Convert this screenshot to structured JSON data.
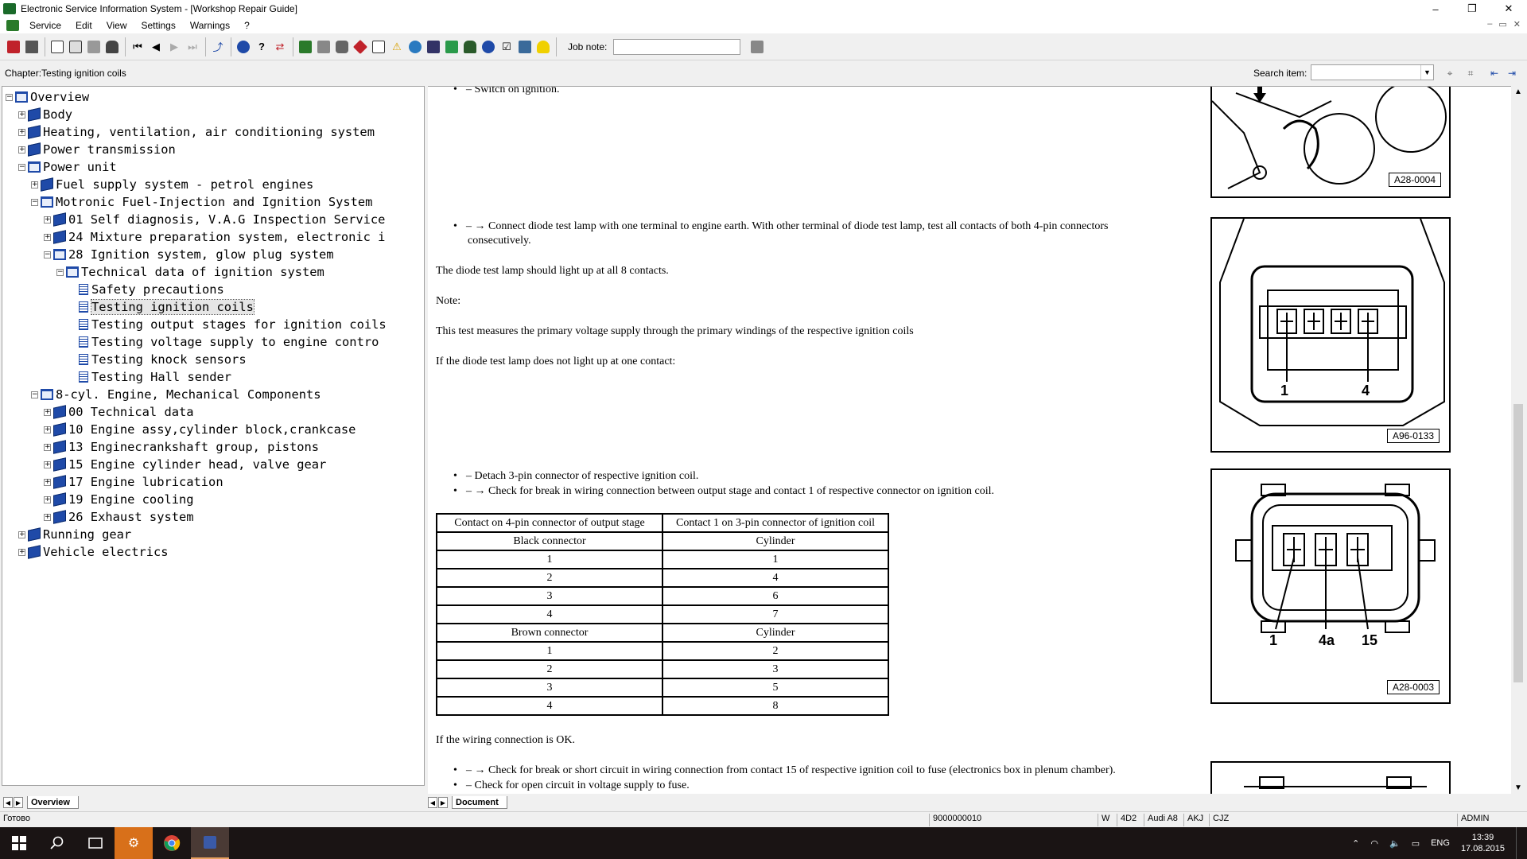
{
  "window": {
    "title": "Electronic Service Information System - [Workshop Repair Guide]",
    "controls": [
      "–",
      "❐",
      "✕"
    ]
  },
  "menu": {
    "items": [
      "Service",
      "Edit",
      "View",
      "Settings",
      "Warnings",
      "?"
    ],
    "mdi_controls": [
      "–",
      "▭",
      "✕"
    ]
  },
  "toolbar": {
    "job_note_label": "Job note:",
    "job_note_value": ""
  },
  "chapter": {
    "text": "Chapter:Testing ignition coils",
    "search_label": "Search item:",
    "search_value": ""
  },
  "tree": [
    {
      "label": "Overview",
      "expander": "−",
      "icon": "book-open",
      "level": 0
    },
    {
      "label": "Body",
      "expander": "+",
      "icon": "book-closed",
      "level": 1
    },
    {
      "label": "Heating, ventilation, air conditioning system",
      "expander": "+",
      "icon": "book-closed",
      "level": 1
    },
    {
      "label": "Power transmission",
      "expander": "+",
      "icon": "book-closed",
      "level": 1
    },
    {
      "label": "Power unit",
      "expander": "−",
      "icon": "book-open",
      "level": 1
    },
    {
      "label": "Fuel supply system - petrol engines",
      "expander": "+",
      "icon": "book-closed",
      "level": 2
    },
    {
      "label": "Motronic Fuel-Injection and Ignition System",
      "expander": "−",
      "icon": "book-open",
      "level": 2
    },
    {
      "label": "01 Self diagnosis, V.A.G Inspection Service",
      "expander": "+",
      "icon": "book-closed",
      "level": 3
    },
    {
      "label": "24 Mixture preparation system, electronic i",
      "expander": "+",
      "icon": "book-closed",
      "level": 3
    },
    {
      "label": "28 Ignition system, glow plug system",
      "expander": "−",
      "icon": "book-open",
      "level": 3
    },
    {
      "label": "Technical data of ignition system",
      "expander": "−",
      "icon": "book-open",
      "level": 4
    },
    {
      "label": "Safety precautions",
      "expander": "",
      "icon": "page",
      "level": 5
    },
    {
      "label": "Testing ignition coils",
      "expander": "",
      "icon": "page",
      "level": 5,
      "selected": true
    },
    {
      "label": "Testing output stages for ignition coils",
      "expander": "",
      "icon": "page",
      "level": 5
    },
    {
      "label": "Testing voltage supply to engine contro",
      "expander": "",
      "icon": "page",
      "level": 5
    },
    {
      "label": "Testing knock sensors",
      "expander": "",
      "icon": "page",
      "level": 5
    },
    {
      "label": "Testing Hall sender",
      "expander": "",
      "icon": "page",
      "level": 5
    },
    {
      "label": "8-cyl. Engine, Mechanical Components",
      "expander": "−",
      "icon": "book-open",
      "level": 2
    },
    {
      "label": "00 Technical data",
      "expander": "+",
      "icon": "book-closed",
      "level": 3
    },
    {
      "label": "10 Engine assy,cylinder block,crankcase",
      "expander": "+",
      "icon": "book-closed",
      "level": 3
    },
    {
      "label": "13 Enginecrankshaft group, pistons",
      "expander": "+",
      "icon": "book-closed",
      "level": 3
    },
    {
      "label": "15 Engine cylinder head, valve gear",
      "expander": "+",
      "icon": "book-closed",
      "level": 3
    },
    {
      "label": "17 Engine lubrication",
      "expander": "+",
      "icon": "book-closed",
      "level": 3
    },
    {
      "label": "19 Engine cooling",
      "expander": "+",
      "icon": "book-closed",
      "level": 3
    },
    {
      "label": "26 Exhaust system",
      "expander": "+",
      "icon": "book-closed",
      "level": 3
    },
    {
      "label": "Running gear",
      "expander": "+",
      "icon": "book-closed",
      "level": 1
    },
    {
      "label": "Vehicle electrics",
      "expander": "+",
      "icon": "book-closed",
      "level": 1
    }
  ],
  "tabs": {
    "overview": "Overview",
    "document": "Document"
  },
  "document": {
    "step1": "– Switch on ignition.",
    "step2_line1": "– → Connect diode test lamp with one terminal to engine earth. With other terminal of diode test lamp, test all contacts of both 4-pin connectors",
    "step2_line2": "consecutively.",
    "p_light": "The diode test lamp should light up at all 8 contacts.",
    "note": "Note:",
    "p_measures": "This test measures the primary voltage supply through the primary windings of the respective ignition coils",
    "p_if_not": "If the diode test lamp does not light up at one contact:",
    "step3": "– Detach 3-pin connector of respective ignition coil.",
    "step4": "– → Check for break in wiring connection between output stage and contact 1 of respective connector on ignition coil.",
    "table": {
      "headers": [
        "Contact on 4-pin connector of output stage",
        "Contact 1 on 3-pin connector of ignition coil"
      ],
      "rows": [
        [
          "Black connector",
          "Cylinder"
        ],
        [
          "1",
          "1"
        ],
        [
          "2",
          "4"
        ],
        [
          "3",
          "6"
        ],
        [
          "4",
          "7"
        ],
        [
          "Brown connector",
          "Cylinder"
        ],
        [
          "1",
          "2"
        ],
        [
          "2",
          "3"
        ],
        [
          "3",
          "5"
        ],
        [
          "4",
          "8"
        ]
      ]
    },
    "p_ok": "If the wiring connection is OK.",
    "step5": "– → Check for break or short circuit in wiring connection from contact 15 of respective ignition coil to fuse (electronics box in plenum chamber).",
    "step6": "– Check for open circuit in voltage supply to fuse."
  },
  "figures": {
    "fig1_label": "A28-0004",
    "fig2_label": "A96-0133",
    "fig2_callouts": [
      "1",
      "4"
    ],
    "fig3_label": "A28-0003",
    "fig3_callouts": [
      "1",
      "4a",
      "15"
    ]
  },
  "status": {
    "left": "Готово",
    "id": "9000000010",
    "cells": [
      "W",
      "4D2",
      "Audi A8",
      "AKJ",
      "CJZ"
    ],
    "user": "ADMIN"
  },
  "taskbar": {
    "lang": "ENG",
    "time": "13:39",
    "date": "17.08.2015"
  }
}
